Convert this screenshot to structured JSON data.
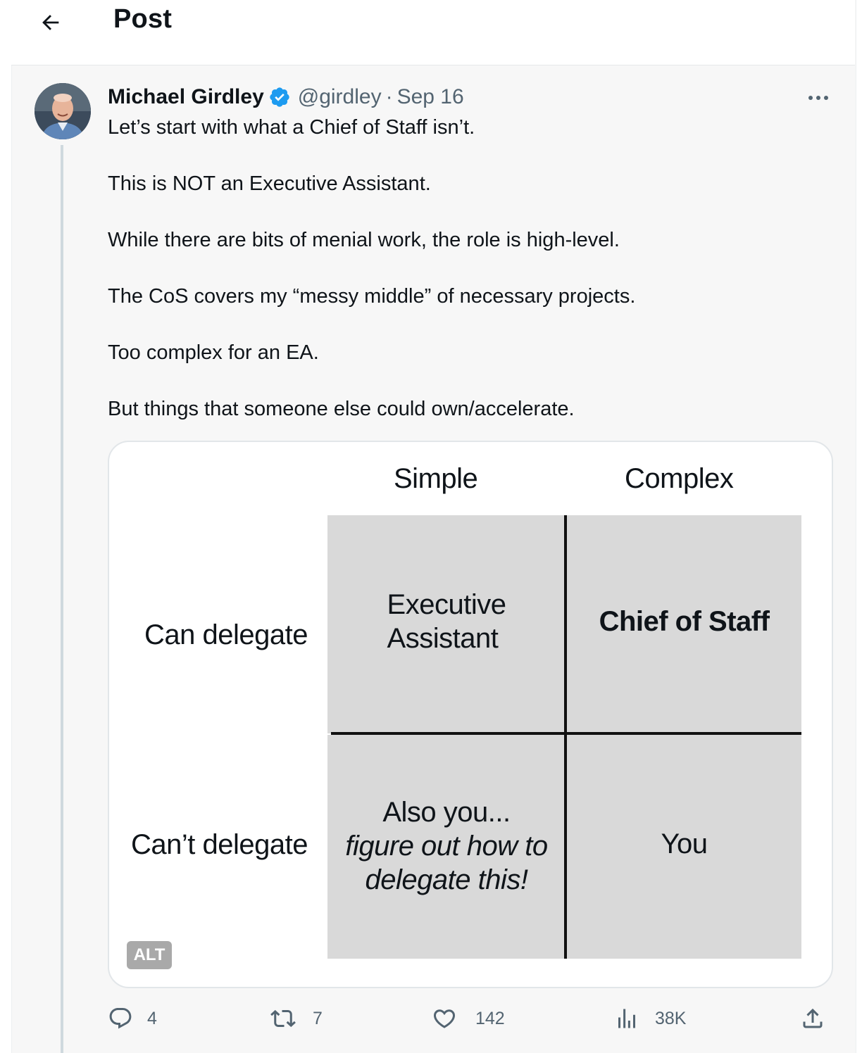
{
  "header": {
    "title": "Post"
  },
  "tweet": {
    "author_name": "Michael Girdley",
    "handle": "@girdley",
    "separator": "·",
    "date": "Sep 16",
    "paragraphs": [
      "Let’s start with what a Chief of Staff isn’t.",
      "This is NOT an Executive Assistant.",
      "While there are bits of menial work, the role is high-level.",
      "The CoS covers my “messy middle” of necessary projects.",
      "Too complex for an EA.",
      "But things that someone else could own/accelerate."
    ],
    "image": {
      "col_headers": [
        "Simple",
        "Complex"
      ],
      "row_headers": [
        "Can delegate",
        "Can’t delegate"
      ],
      "cells": {
        "top_left": [
          "Executive",
          "Assistant"
        ],
        "top_right": "Chief of Staff",
        "bottom_left": [
          "Also you...",
          "figure out how to",
          "delegate this!"
        ],
        "bottom_right": "You"
      },
      "alt_label": "ALT"
    },
    "actions": {
      "replies": "4",
      "reposts": "7",
      "likes": "142",
      "views": "38K"
    }
  },
  "colors": {
    "text": "#0f1419",
    "secondary": "#536471",
    "verified": "#1d9bf0",
    "cell_gray": "#d9d9d9"
  },
  "icons": {
    "back": "arrow-left-icon",
    "verified": "verified-badge-icon",
    "more": "more-dots-icon",
    "reply": "reply-bubble-icon",
    "repost": "repost-icon",
    "like": "heart-icon",
    "views": "bar-chart-icon",
    "share": "share-upload-icon"
  }
}
